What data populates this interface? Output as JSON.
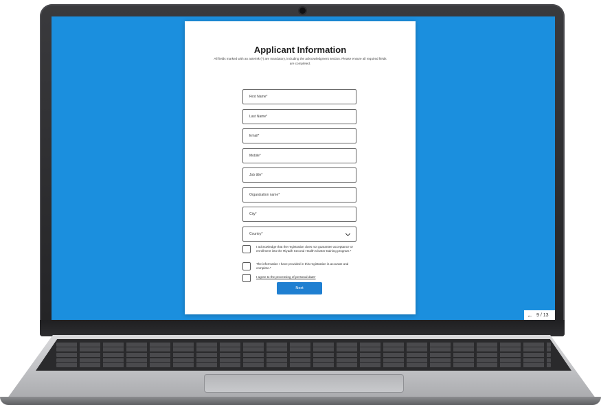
{
  "form": {
    "title": "Applicant Information",
    "instructions": "All fields marked with an asterisk (*) are mandatory, including the acknowledgment section. Please ensure all required fields are completed.",
    "fields": {
      "first_name": "First Name*",
      "last_name": "Last Name*",
      "email": "Email*",
      "mobile": "Mobile*",
      "job_title": "Job title*",
      "organization": "Organization name*",
      "city": "City*",
      "country": "Country*"
    },
    "checkboxes": {
      "acknowledge": "I acknowledge that the registration does not guarantee acceptance or enrollment into the Riyadh Second Health Cluster training program.*",
      "accurate": "The information I have provided in this registration is accurate and complete.*",
      "consent": "I agree to the processing of personal data*"
    },
    "next_label": "Next"
  },
  "pager": {
    "arrow_icon": "arrow-left-icon",
    "arrow_glyph": "←",
    "page_text": "9 / 13"
  },
  "colors": {
    "screen_background": "#1b8fde",
    "button": "#1f7fd1"
  }
}
